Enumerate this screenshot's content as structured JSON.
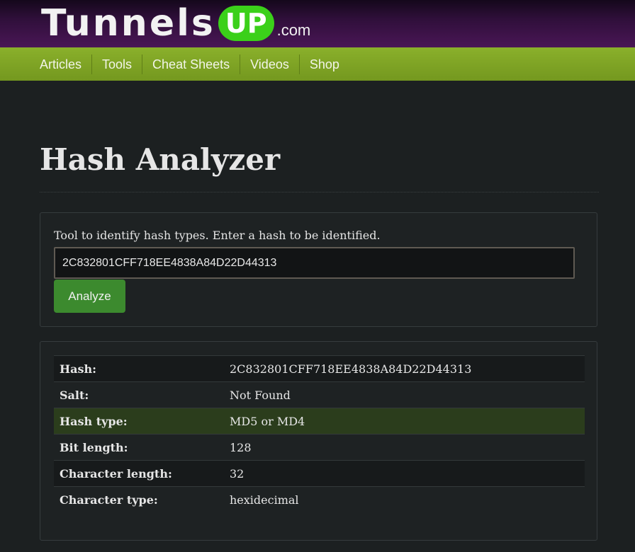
{
  "logo": {
    "tunnels": "Tunnels",
    "up": "UP",
    "com": ".com"
  },
  "nav": {
    "items": [
      "Articles",
      "Tools",
      "Cheat Sheets",
      "Videos",
      "Shop"
    ]
  },
  "page": {
    "title": "Hash Analyzer"
  },
  "form": {
    "description": "Tool to identify hash types. Enter a hash to be identified.",
    "hash_value": "2C832801CFF718EE4838A84D22D44313",
    "analyze_label": "Analyze"
  },
  "results": {
    "rows": [
      {
        "label": "Hash:",
        "value": "2C832801CFF718EE4838A84D22D44313"
      },
      {
        "label": "Salt:",
        "value": "Not Found"
      },
      {
        "label": "Hash type:",
        "value": "MD5 or MD4"
      },
      {
        "label": "Bit length:",
        "value": "128"
      },
      {
        "label": "Character length:",
        "value": "32"
      },
      {
        "label": "Character type:",
        "value": "hexidecimal"
      }
    ]
  },
  "colors": {
    "header_purple": "#4a1656",
    "nav_green": "#8ab02b",
    "logo_up_green": "#3bd01a",
    "button_green": "#3c8a2e",
    "highlight_row": "#2b3d1c",
    "background": "#1c2021"
  }
}
